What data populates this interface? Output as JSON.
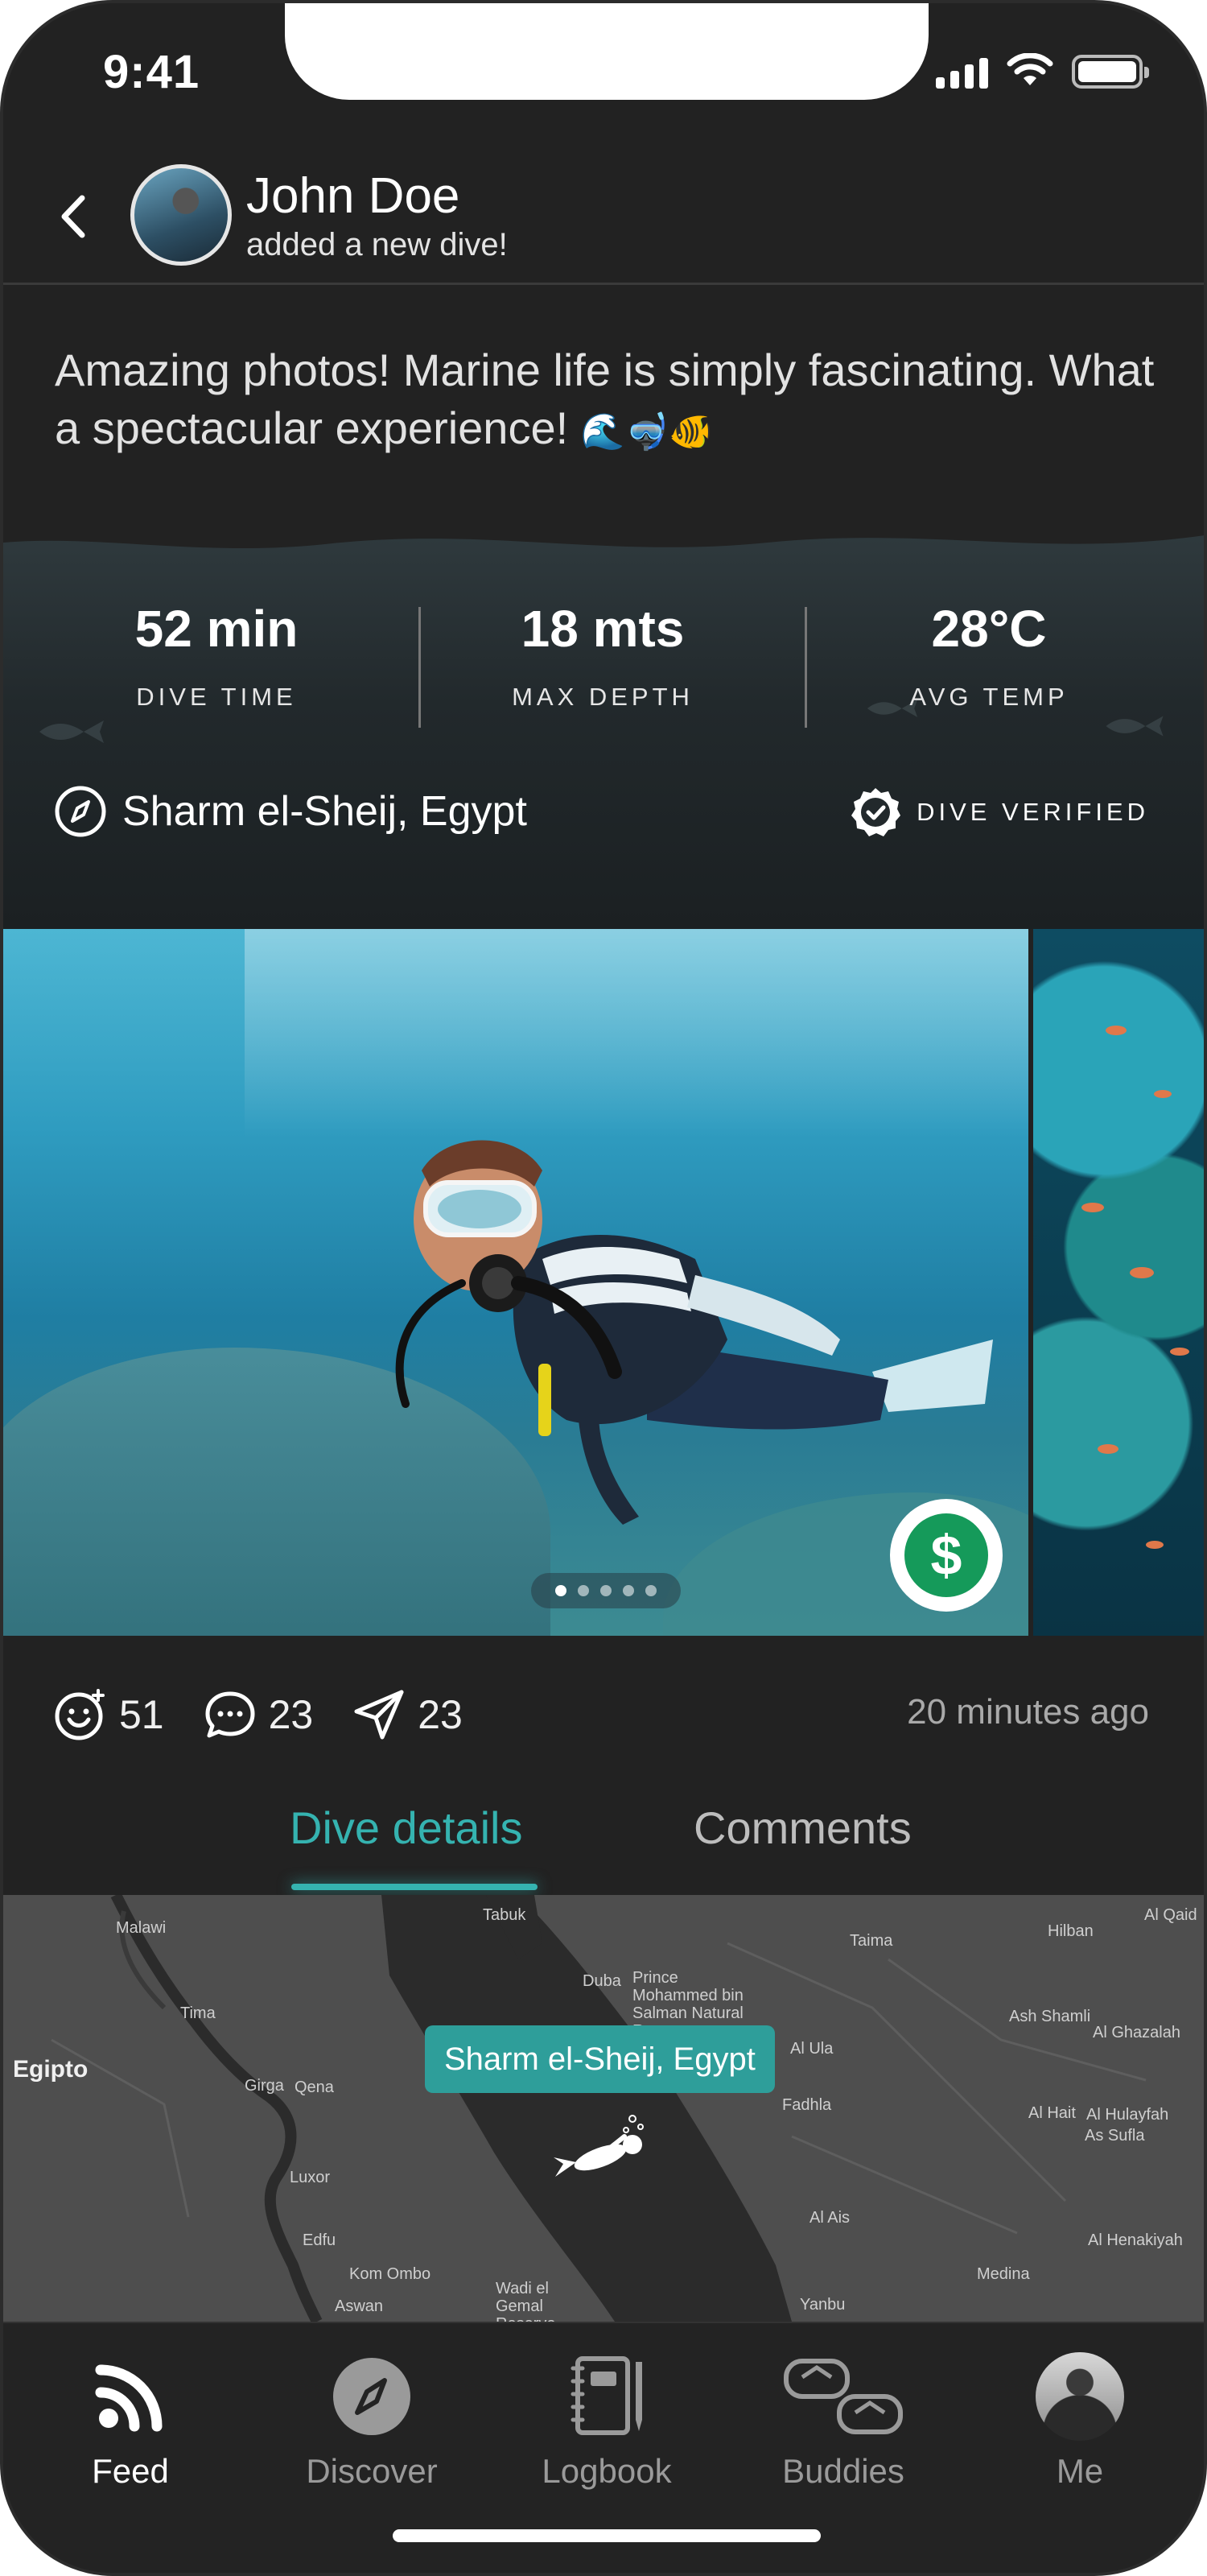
{
  "status_bar": {
    "time": "9:41"
  },
  "header": {
    "user_name": "John Doe",
    "subtitle": "added a new dive!"
  },
  "post": {
    "text": "Amazing photos! Marine life is simply fascinating. What a spectacular experience!",
    "emojis": "🌊🤿🐠"
  },
  "dive_stats": {
    "dive_time_value": "52 min",
    "dive_time_label": "DIVE TIME",
    "max_depth_value": "18 mts",
    "max_depth_label": "MAX DEPTH",
    "avg_temp_value": "28°C",
    "avg_temp_label": "AVG TEMP",
    "location": "Sharm el-Sheij, Egypt",
    "verified_label": "DIVE VERIFIED"
  },
  "carousel": {
    "current": 1,
    "total": 5,
    "price_symbol": "$"
  },
  "reactions": {
    "likes": "51",
    "comments": "23",
    "shares": "23",
    "time_ago": "20 minutes ago"
  },
  "tabs": [
    {
      "label": "Dive details",
      "active": true
    },
    {
      "label": "Comments",
      "active": false
    }
  ],
  "map": {
    "marker_label": "Sharm el-Sheij, Egypt",
    "country_label": "Egipto",
    "places": [
      "Malawi",
      "Qena",
      "Luxor",
      "Edfu",
      "Aswan",
      "Kom Ombo",
      "Girga",
      "Tima",
      "Tabuk",
      "Duba",
      "Al Ula",
      "Fadhla",
      "Al Ais",
      "Medina",
      "Yanbu",
      "Taima",
      "Hilban",
      "Al Qaid",
      "Ash Shamli",
      "Al Ghazalah",
      "Al Hait",
      "Al Hulayfah",
      "As Sufla",
      "Al Henakiyah",
      "Prince Mohammed bin Salman Natural Reserve",
      "Wadi el Gemal Reserve"
    ]
  },
  "bottom_nav": [
    {
      "label": "Feed",
      "icon": "rss-icon",
      "active": true
    },
    {
      "label": "Discover",
      "icon": "compass-icon",
      "active": false
    },
    {
      "label": "Logbook",
      "icon": "notebook-icon",
      "active": false
    },
    {
      "label": "Buddies",
      "icon": "dive-mask-icon",
      "active": false
    },
    {
      "label": "Me",
      "icon": "avatar",
      "active": false
    }
  ],
  "colors": {
    "accent": "#35b3b0",
    "background": "#222222",
    "price_badge": "#159a5a"
  }
}
